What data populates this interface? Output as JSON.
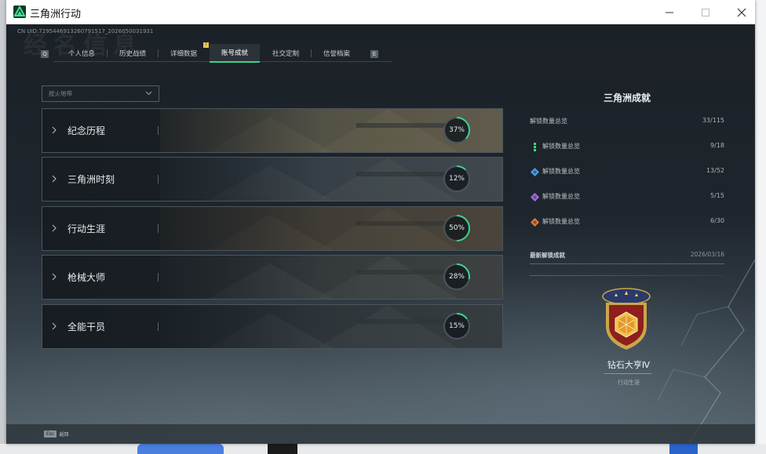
{
  "window": {
    "title": "三角洲行动",
    "controls": [
      "minimize",
      "maximize",
      "close"
    ]
  },
  "header": {
    "big_title": "经名信息",
    "uid": "CN UID:7295446913260791517_2026050031931"
  },
  "tabs": [
    {
      "label": "个人信息",
      "active": false
    },
    {
      "label": "历史战绩",
      "active": false
    },
    {
      "label": "详细数据",
      "active": false
    },
    {
      "label": "账号成就",
      "active": true,
      "badge": "!"
    },
    {
      "label": "社交定制",
      "active": false
    },
    {
      "label": "信誉档案",
      "active": false
    }
  ],
  "filter": {
    "value": "按火地带"
  },
  "categories": [
    {
      "label": "纪念历程",
      "percent": 37,
      "percent_text": "37%"
    },
    {
      "label": "三角洲时刻",
      "percent": 12,
      "percent_text": "12%"
    },
    {
      "label": "行动生涯",
      "percent": 50,
      "percent_text": "50%"
    },
    {
      "label": "枪械大师",
      "percent": 28,
      "percent_text": "28%"
    },
    {
      "label": "全能干员",
      "percent": 15,
      "percent_text": "15%"
    }
  ],
  "side": {
    "title": "三角洲成就",
    "total": {
      "label": "解锁数量总览",
      "value": "33/115"
    },
    "rows": [
      {
        "label": "解锁数量总览",
        "value": "9/18",
        "icon": "green-chain-icon",
        "color": "#3ed68c"
      },
      {
        "label": "解锁数量总览",
        "value": "13/52",
        "icon": "blue-diamond-icon",
        "color": "#4a9be8"
      },
      {
        "label": "解锁数量总览",
        "value": "5/15",
        "icon": "purple-diamond-icon",
        "color": "#a06ae0"
      },
      {
        "label": "解锁数量总览",
        "value": "6/30",
        "icon": "orange-diamond-icon",
        "color": "#e07a3a"
      }
    ],
    "latest": {
      "label": "最新解锁成就",
      "date": "2026/03/16"
    },
    "badge": {
      "name": "钻石大亨Ⅳ",
      "category": "行动生涯"
    }
  },
  "bottom": {
    "key": "Esc",
    "label": "返回"
  },
  "colors": {
    "accent": "#39d48a"
  }
}
